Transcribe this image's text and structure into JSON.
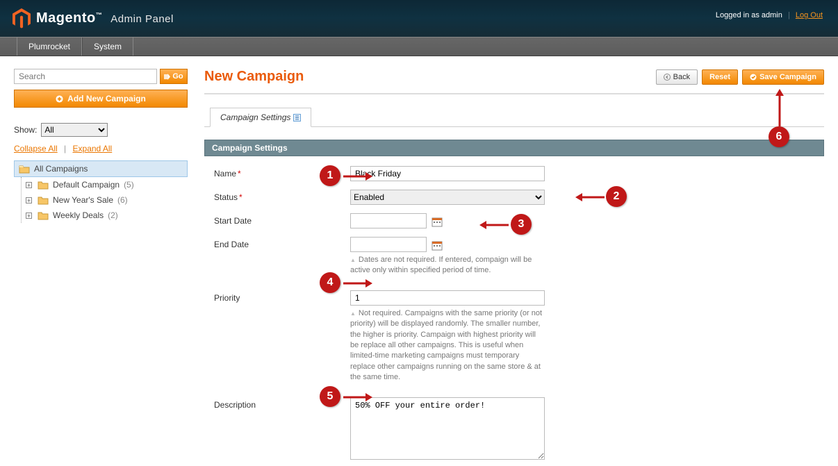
{
  "header": {
    "brand": "Magento",
    "brand_suffix": "Admin Panel",
    "logged_in": "Logged in as admin",
    "logout": "Log Out"
  },
  "menu": [
    "Plumrocket",
    "System"
  ],
  "sidebar": {
    "search_placeholder": "Search",
    "go_label": "Go",
    "add_new": "Add New Campaign",
    "show_label": "Show:",
    "show_value": "All",
    "collapse": "Collapse All",
    "expand": "Expand All",
    "root": "All Campaigns",
    "children": [
      {
        "label": "Default Campaign",
        "count": "(5)"
      },
      {
        "label": "New Year's Sale",
        "count": "(6)"
      },
      {
        "label": "Weekly Deals",
        "count": "(2)"
      }
    ]
  },
  "page": {
    "title": "New Campaign",
    "btn_back": "Back",
    "btn_reset": "Reset",
    "btn_save": "Save Campaign",
    "tab_label": "Campaign Settings",
    "section_title": "Campaign Settings"
  },
  "form": {
    "name_label": "Name",
    "name_value": "Black Friday",
    "status_label": "Status",
    "status_value": "Enabled",
    "start_label": "Start Date",
    "start_value": "",
    "end_label": "End Date",
    "end_value": "",
    "dates_hint": "Dates are not required. If entered, compaign will be active only within specified period of time.",
    "priority_label": "Priority",
    "priority_value": "1",
    "priority_hint": "Not required. Campaigns with the same priority (or not priority) will be displayed randomly. The smaller number, the higher is priority. Campaign with highest priority will be replace all other campaigns. This is useful when limited-time marketing campaigns must temporary replace other campaigns running on the same store & at the same time.",
    "desc_label": "Description",
    "desc_value": "50% OFF your entire order!"
  },
  "markers": [
    "1",
    "2",
    "3",
    "4",
    "5",
    "6"
  ]
}
